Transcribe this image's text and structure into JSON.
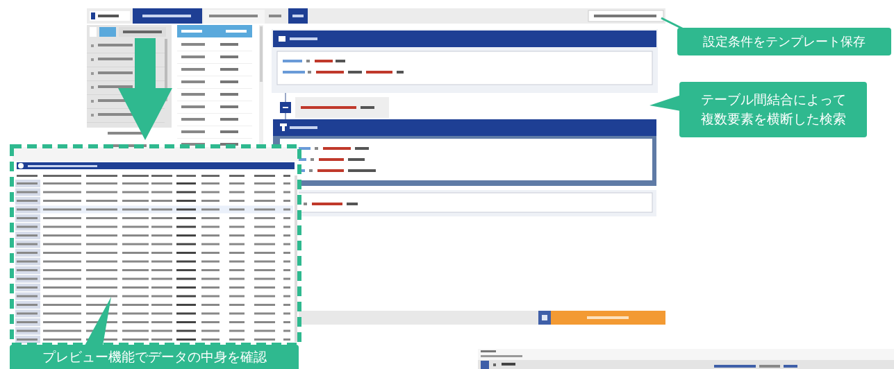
{
  "callouts": [
    {
      "lines": [
        "設定条件をテンプレート保存"
      ]
    },
    {
      "lines": [
        "テーブル間結合によって",
        "複数要素を横断した検索"
      ]
    },
    {
      "lines": [
        "プレビュー機能でデータの中身を確認"
      ]
    }
  ]
}
